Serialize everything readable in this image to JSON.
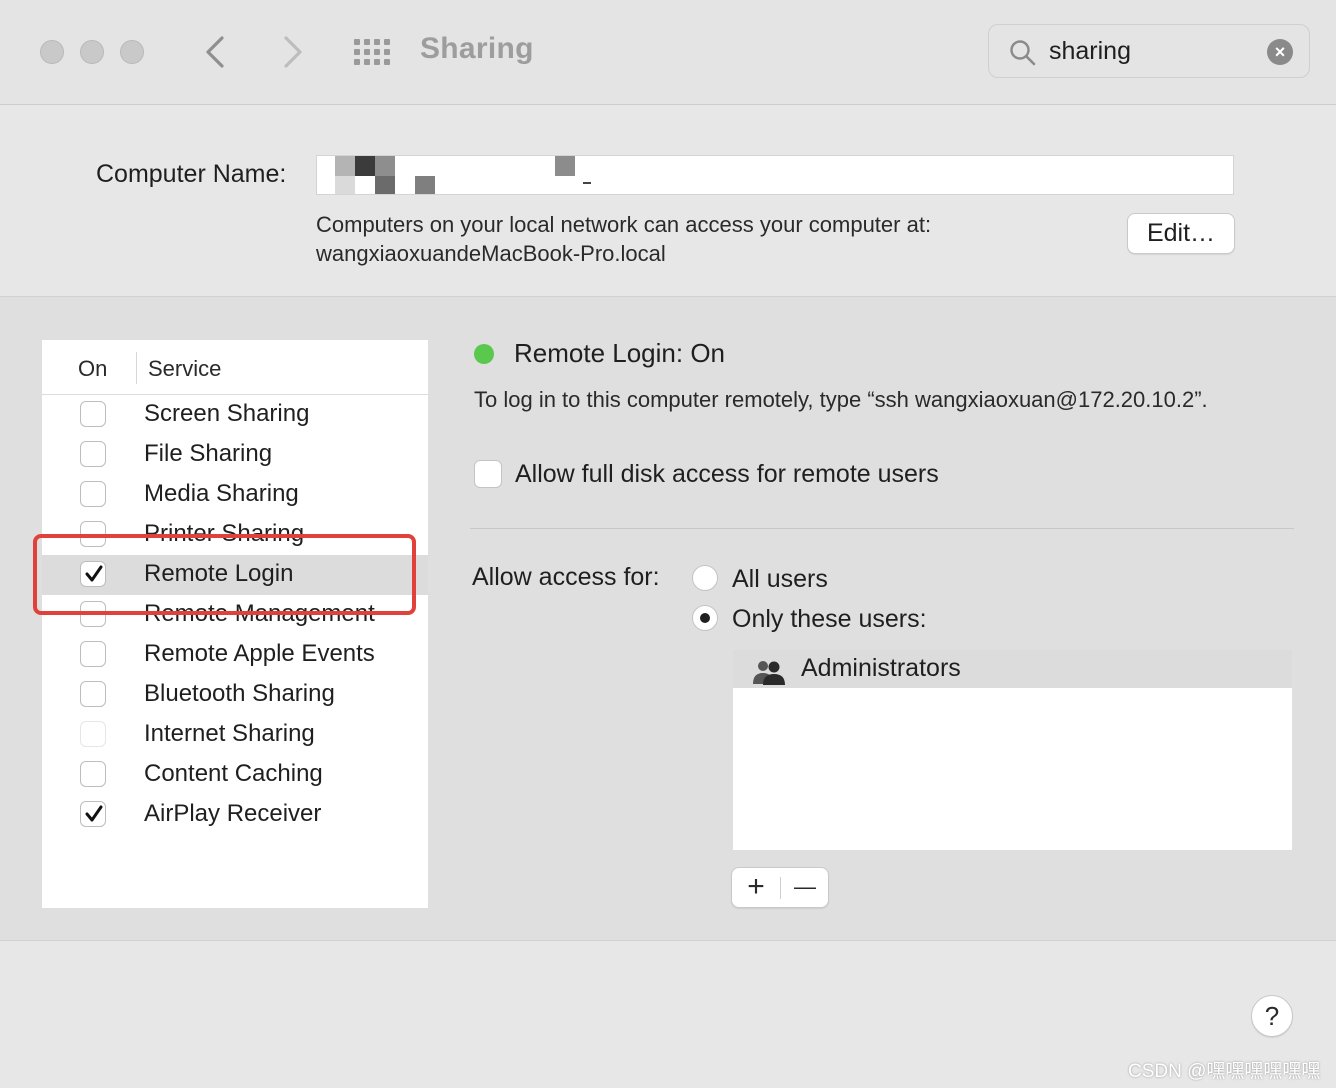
{
  "window": {
    "title": "Sharing",
    "search_value": "sharing",
    "clear_glyph": "×"
  },
  "computer_name": {
    "label": "Computer Name:",
    "value": "",
    "description_line1": "Computers on your local network can access your computer at:",
    "description_line2": "wangxiaoxuandeMacBook-Pro.local",
    "edit_button": "Edit…"
  },
  "services": {
    "header_on": "On",
    "header_service": "Service",
    "items": [
      {
        "label": "Screen Sharing",
        "checked": false
      },
      {
        "label": "File Sharing",
        "checked": false
      },
      {
        "label": "Media Sharing",
        "checked": false
      },
      {
        "label": "Printer Sharing",
        "checked": false
      },
      {
        "label": "Remote Login",
        "checked": true,
        "selected": true
      },
      {
        "label": "Remote Management",
        "checked": false
      },
      {
        "label": "Remote Apple Events",
        "checked": false
      },
      {
        "label": "Bluetooth Sharing",
        "checked": false
      },
      {
        "label": "Internet Sharing",
        "checked": false,
        "disabled": true
      },
      {
        "label": "Content Caching",
        "checked": false
      },
      {
        "label": "AirPlay Receiver",
        "checked": true
      }
    ]
  },
  "detail": {
    "status": "Remote Login: On",
    "status_color": "#5ac84c",
    "instructions": "To log in to this computer remotely, type “ssh wangxiaoxuan@172.20.10.2”.",
    "full_disk_access_label": "Allow full disk access for remote users",
    "full_disk_access_checked": false,
    "access_label": "Allow access for:",
    "option_all": "All users",
    "option_only": "Only these users:",
    "selected_option": "only",
    "users": [
      "Administrators"
    ],
    "add_glyph": "+",
    "remove_glyph": "—"
  },
  "help_glyph": "?",
  "watermark": "CSDN @嘿嘿嘿嘿嘿嘿",
  "highlight_color": "#e0413a"
}
